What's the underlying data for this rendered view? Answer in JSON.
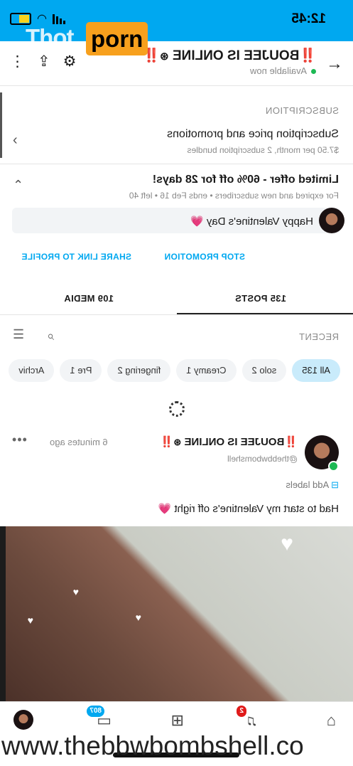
{
  "watermark": {
    "brand_a": "Thot",
    "brand_b": "porn",
    "url": "www.thebbwbombshell.co"
  },
  "status_bar": {
    "time": "12:45"
  },
  "header": {
    "title_bang": "‼️",
    "title": "BOUJEE IS ONLINE",
    "status": "Available now",
    "back_icon": "arrow-back-icon",
    "settings_icon": "gear-icon",
    "share_icon": "share-icon",
    "more_icon": "more-vertical-icon"
  },
  "subscription": {
    "section_label": "SUBSCRIPTION",
    "title": "Subscription price and promotions",
    "detail": "$7.50 per month, 2 subscription bundles"
  },
  "offer": {
    "title": "Limited offer - 60% off for 28 days!",
    "detail": "For expired and new subscribers  •  ends Feb 16  •  left 40",
    "message": "Happy Valentine's Day",
    "message_emoji": "💗",
    "stop_label": "STOP PROMOTION",
    "share_label": "SHARE LINK TO PROFILE"
  },
  "tabs": {
    "posts": "135 POSTS",
    "media": "109 MEDIA"
  },
  "feed": {
    "sort_label": "RECENT",
    "chips": [
      "All 135",
      "solo 2",
      "Creamy 1",
      "fingering 2",
      "Pre 1",
      "Archiv"
    ]
  },
  "post": {
    "name_bang": "‼️",
    "name": "BOUJEE IS ONLINE",
    "handle": "@thebbwbomshell",
    "time": "6 minutes ago",
    "add_labels": "Add labels",
    "caption": "Had to start my Valentine's off right",
    "caption_emoji": "💗"
  },
  "nav": {
    "messages_badge": "807",
    "notifications_badge": "2"
  },
  "colors": {
    "accent": "#00a8f0",
    "online": "#1db954",
    "alert": "#e01b1b",
    "watermark": "#f7a01d"
  }
}
